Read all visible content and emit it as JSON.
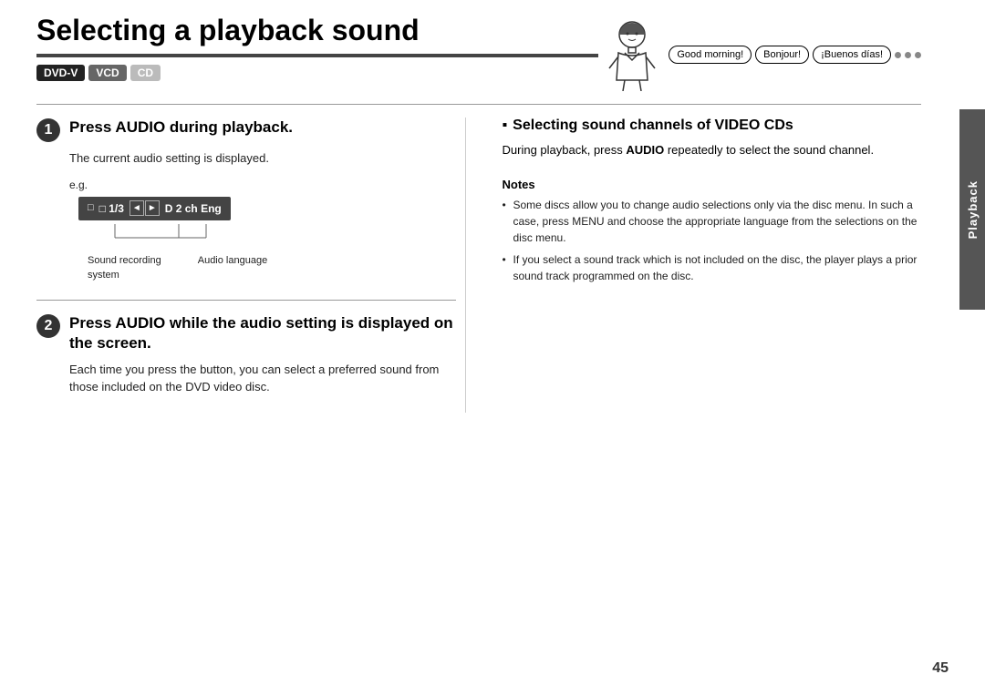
{
  "page": {
    "title": "Selecting a playback sound",
    "title_bar_visible": true,
    "sidebar_label": "Playback",
    "page_number": "45"
  },
  "formats": {
    "dvd_v": "DVD-V",
    "vcd": "VCD",
    "cd": "CD"
  },
  "character": {
    "speech1": "Good morning!",
    "speech2": "Bonjour!",
    "speech3": "¡Buenos días!"
  },
  "step1": {
    "number": "1",
    "title": "Press AUDIO during playback.",
    "body": "The current audio setting is displayed.",
    "eg_label": "e.g.",
    "display_text1": "□ 1/3",
    "display_text2": "D 2 ch Eng",
    "label1": "Sound recording",
    "label1b": "system",
    "label2": "Audio language"
  },
  "step2": {
    "number": "2",
    "title": "Press AUDIO while the audio setting is displayed on the screen.",
    "body": "Each time you press the button, you can select a preferred sound from those included on the DVD video disc."
  },
  "right_section": {
    "bullet": "▪",
    "title": "Selecting sound channels of VIDEO CDs",
    "body1": "During playback, press ",
    "body_bold": "AUDIO",
    "body2": " repeatedly to select the sound channel."
  },
  "notes": {
    "title": "Notes",
    "note1": "Some discs allow you to change audio selections only via the disc menu. In such a case, press MENU and choose the appropriate language from the selections on the disc menu.",
    "note2": "If you select a sound track which is not included on the disc, the player plays a prior sound track programmed on the disc."
  }
}
